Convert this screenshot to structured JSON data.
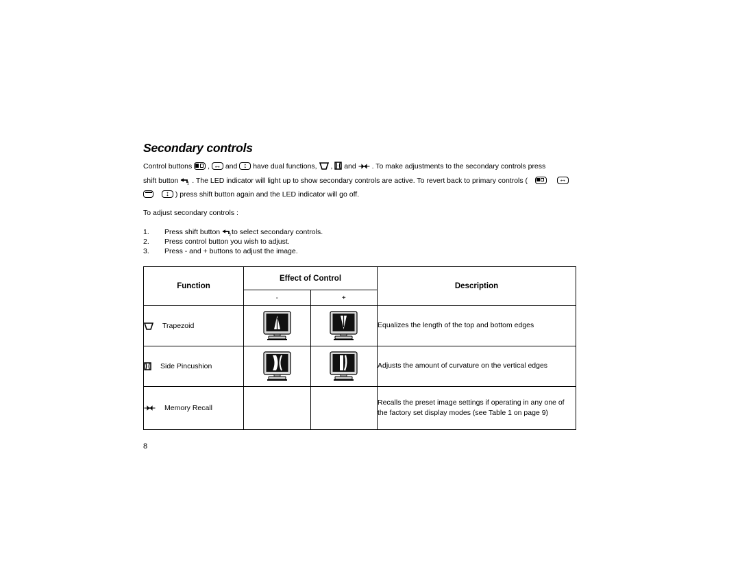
{
  "document": {
    "heading": "Secondary controls",
    "page_number": "8"
  },
  "intro": {
    "line1_a": "Control buttons",
    "line1_b": ",",
    "line1_c": "and",
    "line1_d": "have dual functions,",
    "line1_e": ",",
    "line1_f": "and",
    "line1_g": ". To make adjustments to the secondary controls press",
    "line2_a": "shift button",
    "line2_b": ". The LED indicator will light up to show secondary controls are active. To revert back to primary controls (",
    "line3_a": ") press shift button again and the LED indicator will go off."
  },
  "instructions": {
    "lead": "To adjust secondary controls :",
    "steps": [
      {
        "num": "1.",
        "text_a": "Press shift button",
        "text_b": "to select secondary controls."
      },
      {
        "num": "2.",
        "text_a": "Press control button you wish to adjust.",
        "text_b": ""
      },
      {
        "num": "3.",
        "text_a": "Press - and + buttons to adjust the image.",
        "text_b": ""
      }
    ]
  },
  "table": {
    "headers": {
      "function": "Function",
      "effect_of_control": "Effect of Control",
      "description": "Description",
      "minus": "-",
      "plus": "+"
    },
    "rows": [
      {
        "icon": "trapezoid-icon",
        "function": "Trapezoid",
        "description": "Equalizes the length of the top and bottom edges"
      },
      {
        "icon": "side-pincushion-icon",
        "function": "Side Pincushion",
        "description": "Adjusts the amount of curvature on the vertical edges"
      },
      {
        "icon": "memory-recall-icon",
        "function": "Memory Recall",
        "description": "Recalls the preset image settings if operating in any one of the factory set display modes (see Table 1 on page 9)"
      }
    ]
  },
  "colors": {
    "text": "#000000",
    "background": "#ffffff",
    "rule": "#000000",
    "screen": "#111111"
  }
}
